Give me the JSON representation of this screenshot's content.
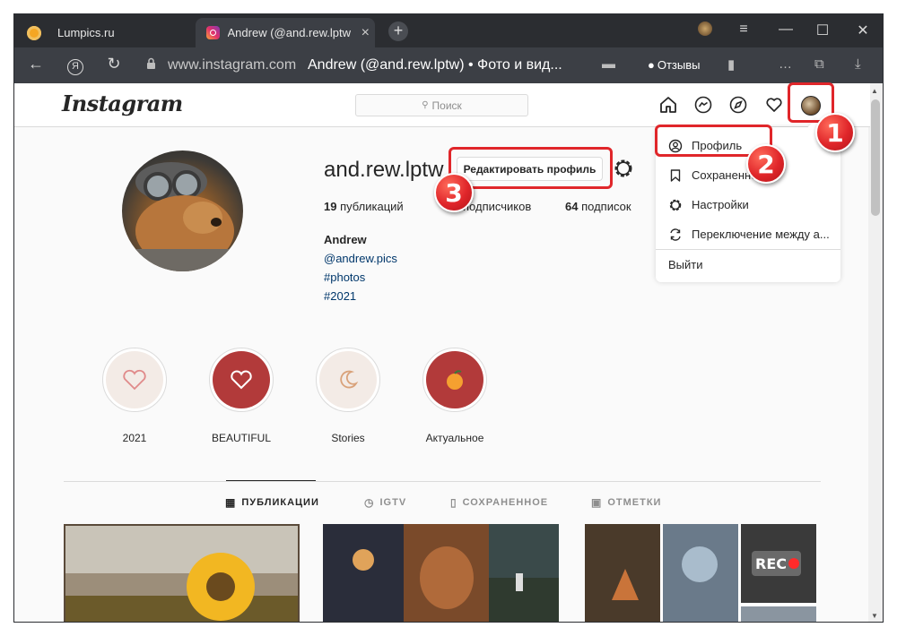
{
  "browser": {
    "tabs": [
      {
        "title": "Lumpics.ru",
        "favicon": "orange-favicon"
      },
      {
        "title": "Andrew (@and.rew.lptw",
        "favicon": "instagram-favicon",
        "active": true
      }
    ],
    "url_host": "www.instagram.com",
    "page_title": "Andrew (@and.rew.lptw) • Фото и вид...",
    "reviews_label": "Отзывы"
  },
  "instagram": {
    "logo": "Instagram",
    "search_placeholder": "Поиск"
  },
  "profile": {
    "username": "and.rew.lptw",
    "edit_button": "Редактировать профиль",
    "stats": {
      "posts_count": "19",
      "posts_label": "публикаций",
      "followers_label": "подписчиков",
      "following_count": "64",
      "following_label": "подписок"
    },
    "bio": {
      "name": "Andrew",
      "handle": "@andrew.pics",
      "tag1": "#photos",
      "tag2": "#2021"
    }
  },
  "highlights": [
    {
      "label": "2021"
    },
    {
      "label": "BEAUTIFUL"
    },
    {
      "label": "Stories"
    },
    {
      "label": "Актуальное"
    }
  ],
  "profile_tabs": [
    "ПУБЛИКАЦИИ",
    "IGTV",
    "СОХРАНЕННОЕ",
    "ОТМЕТКИ"
  ],
  "dropdown": {
    "profile": "Профиль",
    "saved": "Сохраненное",
    "settings": "Настройки",
    "switch": "Переключение между а...",
    "logout": "Выйти"
  },
  "annotations": {
    "step1": "1",
    "step2": "2",
    "step3": "3"
  },
  "colors": {
    "annotation_red": "#e0262a",
    "browser_chrome": "#2b2d31",
    "ig_link": "#00376b"
  }
}
